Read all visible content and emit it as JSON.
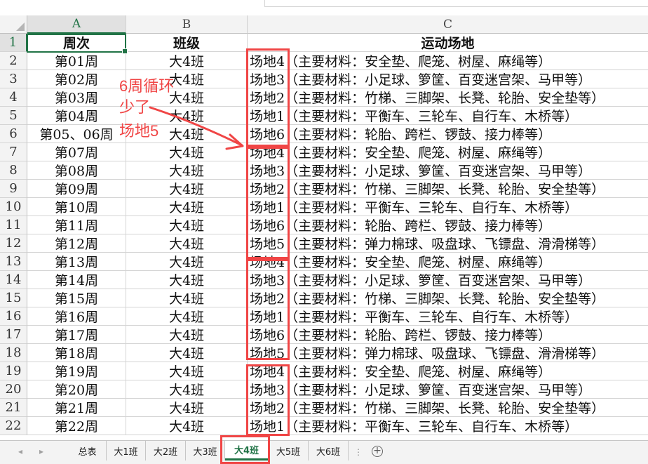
{
  "columns": {
    "a": "A",
    "b": "B",
    "c": "C"
  },
  "header_row": {
    "row_number": "1",
    "week": "周次",
    "class": "班级",
    "venue": "运动场地"
  },
  "rows": [
    {
      "n": "2",
      "week": "第01周",
      "class": "大4班",
      "venue": "场地4（主要材料：安全垫、爬笼、树屋、麻绳等）"
    },
    {
      "n": "3",
      "week": "第02周",
      "class": "大4班",
      "venue": "场地3（主要材料：小足球、箩筐、百变迷宫架、马甲等）"
    },
    {
      "n": "4",
      "week": "第03周",
      "class": "大4班",
      "venue": "场地2（主要材料：竹梯、三脚架、长凳、轮胎、安全垫等）"
    },
    {
      "n": "5",
      "week": "第04周",
      "class": "大4班",
      "venue": "场地1（主要材料：平衡车、三轮车、自行车、木桥等）"
    },
    {
      "n": "6",
      "week": "第05、06周",
      "class": "大4班",
      "venue": "场地6（主要材料：轮胎、跨栏、锣鼓、接力棒等）"
    },
    {
      "n": "7",
      "week": "第07周",
      "class": "大4班",
      "venue": "场地4（主要材料：安全垫、爬笼、树屋、麻绳等）"
    },
    {
      "n": "8",
      "week": "第08周",
      "class": "大4班",
      "venue": "场地3（主要材料：小足球、箩筐、百变迷宫架、马甲等）"
    },
    {
      "n": "9",
      "week": "第09周",
      "class": "大4班",
      "venue": "场地2（主要材料：竹梯、三脚架、长凳、轮胎、安全垫等）"
    },
    {
      "n": "10",
      "week": "第10周",
      "class": "大4班",
      "venue": "场地1（主要材料：平衡车、三轮车、自行车、木桥等）"
    },
    {
      "n": "11",
      "week": "第11周",
      "class": "大4班",
      "venue": "场地6（主要材料：轮胎、跨栏、锣鼓、接力棒等）"
    },
    {
      "n": "12",
      "week": "第12周",
      "class": "大4班",
      "venue": "场地5（主要材料：弹力棉球、吸盘球、飞镖盘、滑滑梯等）"
    },
    {
      "n": "13",
      "week": "第13周",
      "class": "大4班",
      "venue": "场地4（主要材料：安全垫、爬笼、树屋、麻绳等）"
    },
    {
      "n": "14",
      "week": "第14周",
      "class": "大4班",
      "venue": "场地3（主要材料：小足球、箩筐、百变迷宫架、马甲等）"
    },
    {
      "n": "15",
      "week": "第15周",
      "class": "大4班",
      "venue": "场地2（主要材料：竹梯、三脚架、长凳、轮胎、安全垫等）"
    },
    {
      "n": "16",
      "week": "第16周",
      "class": "大4班",
      "venue": "场地1（主要材料：平衡车、三轮车、自行车、木桥等）"
    },
    {
      "n": "17",
      "week": "第17周",
      "class": "大4班",
      "venue": "场地6（主要材料：轮胎、跨栏、锣鼓、接力棒等）"
    },
    {
      "n": "18",
      "week": "第18周",
      "class": "大4班",
      "venue": "场地5（主要材料：弹力棉球、吸盘球、飞镖盘、滑滑梯等）"
    },
    {
      "n": "19",
      "week": "第19周",
      "class": "大4班",
      "venue": "场地4（主要材料：安全垫、爬笼、树屋、麻绳等）"
    },
    {
      "n": "20",
      "week": "第20周",
      "class": "大4班",
      "venue": "场地3（主要材料：小足球、箩筐、百变迷宫架、马甲等）"
    },
    {
      "n": "21",
      "week": "第21周",
      "class": "大4班",
      "venue": "场地2（主要材料：竹梯、三脚架、长凳、轮胎、安全垫等）"
    },
    {
      "n": "22",
      "week": "第22周",
      "class": "大4班",
      "venue": "场地1（主要材料：平衡车、三轮车、自行车、木桥等）"
    }
  ],
  "annotation": {
    "line1": "6周循环",
    "line2": "少了",
    "line3": "场地5"
  },
  "sheet_tabs": [
    {
      "label": "总表",
      "active": false
    },
    {
      "label": "大1班",
      "active": false
    },
    {
      "label": "大2班",
      "active": false
    },
    {
      "label": "大3班",
      "active": false
    },
    {
      "label": "大4班",
      "active": true
    },
    {
      "label": "大5班",
      "active": false
    },
    {
      "label": "大6班",
      "active": false
    }
  ],
  "add_sheet_symbol": "+",
  "nav_prev_symbol": "◂",
  "nav_next_symbol": "▸",
  "tab_overflow_symbol": "⋮",
  "colors": {
    "accent": "#217346",
    "annotation_red": "#f04545",
    "header_bg": "#f3f3f3"
  }
}
